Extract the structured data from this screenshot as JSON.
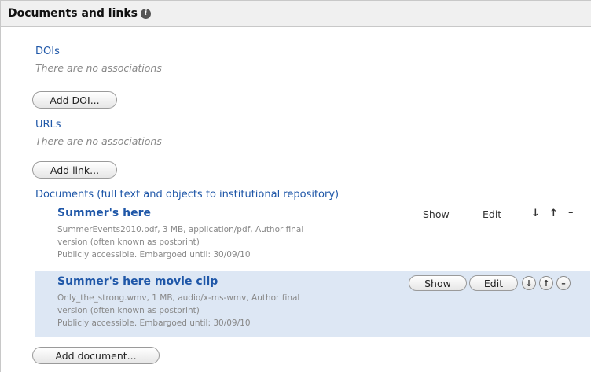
{
  "header": {
    "title": "Documents and links",
    "info_icon": "i"
  },
  "dois": {
    "label": "DOIs",
    "empty_text": "There are no associations",
    "add_button": "Add DOI..."
  },
  "urls": {
    "label": "URLs",
    "empty_text": "There are no associations",
    "add_button": "Add link..."
  },
  "documents": {
    "label": "Documents (full text and objects to institutional repository)",
    "add_button": "Add document...",
    "items": [
      {
        "title": "Summer's here",
        "meta_line1": "SummerEvents2010.pdf, 3 MB, application/pdf, Author final",
        "meta_line2": "version (often known as postprint)",
        "meta_line3": "Publicly accessible. Embargoed until: 30/09/10",
        "show": "Show",
        "edit": "Edit",
        "down": "↓",
        "up": "↑",
        "remove": "–"
      },
      {
        "title": "Summer's here movie clip",
        "meta_line1": "Only_the_strong.wmv, 1 MB, audio/x-ms-wmv, Author final",
        "meta_line2": "version (often known as postprint)",
        "meta_line3": "Publicly accessible. Embargoed until: 30/09/10",
        "show": "Show",
        "edit": "Edit",
        "down": "↓",
        "up": "↑",
        "remove": "–"
      }
    ]
  }
}
